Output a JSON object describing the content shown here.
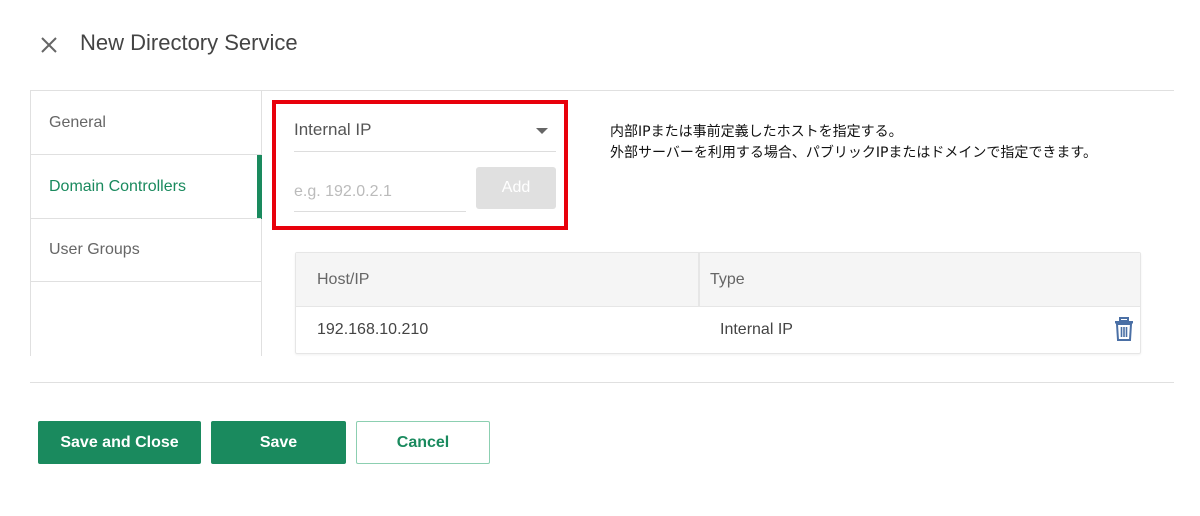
{
  "dialog": {
    "title": "New Directory Service",
    "close_icon": "close-icon"
  },
  "sidebar": {
    "items": [
      {
        "label": "General",
        "active": false
      },
      {
        "label": "Domain Controllers",
        "active": true
      },
      {
        "label": "User Groups",
        "active": false
      }
    ]
  },
  "form": {
    "type_select": {
      "value": "Internal IP",
      "icon": "chevron-down-icon"
    },
    "ip_input": {
      "value": "",
      "placeholder": "e.g. 192.0.2.1"
    },
    "add_label": "Add",
    "note_lines": [
      "内部IPまたは事前定義したホストを指定する。",
      "外部サーバーを利用する場合、パブリックIPまたはドメインで指定できます。"
    ]
  },
  "table": {
    "headers": [
      "Host/IP",
      "Type"
    ],
    "rows": [
      {
        "host": "192.168.10.210",
        "type": "Internal IP",
        "action_icon": "trash-icon"
      }
    ]
  },
  "footer": {
    "save_close_label": "Save and Close",
    "save_label": "Save",
    "cancel_label": "Cancel"
  },
  "colors": {
    "accent": "#1a8a5e",
    "highlight": "#e8000b"
  }
}
